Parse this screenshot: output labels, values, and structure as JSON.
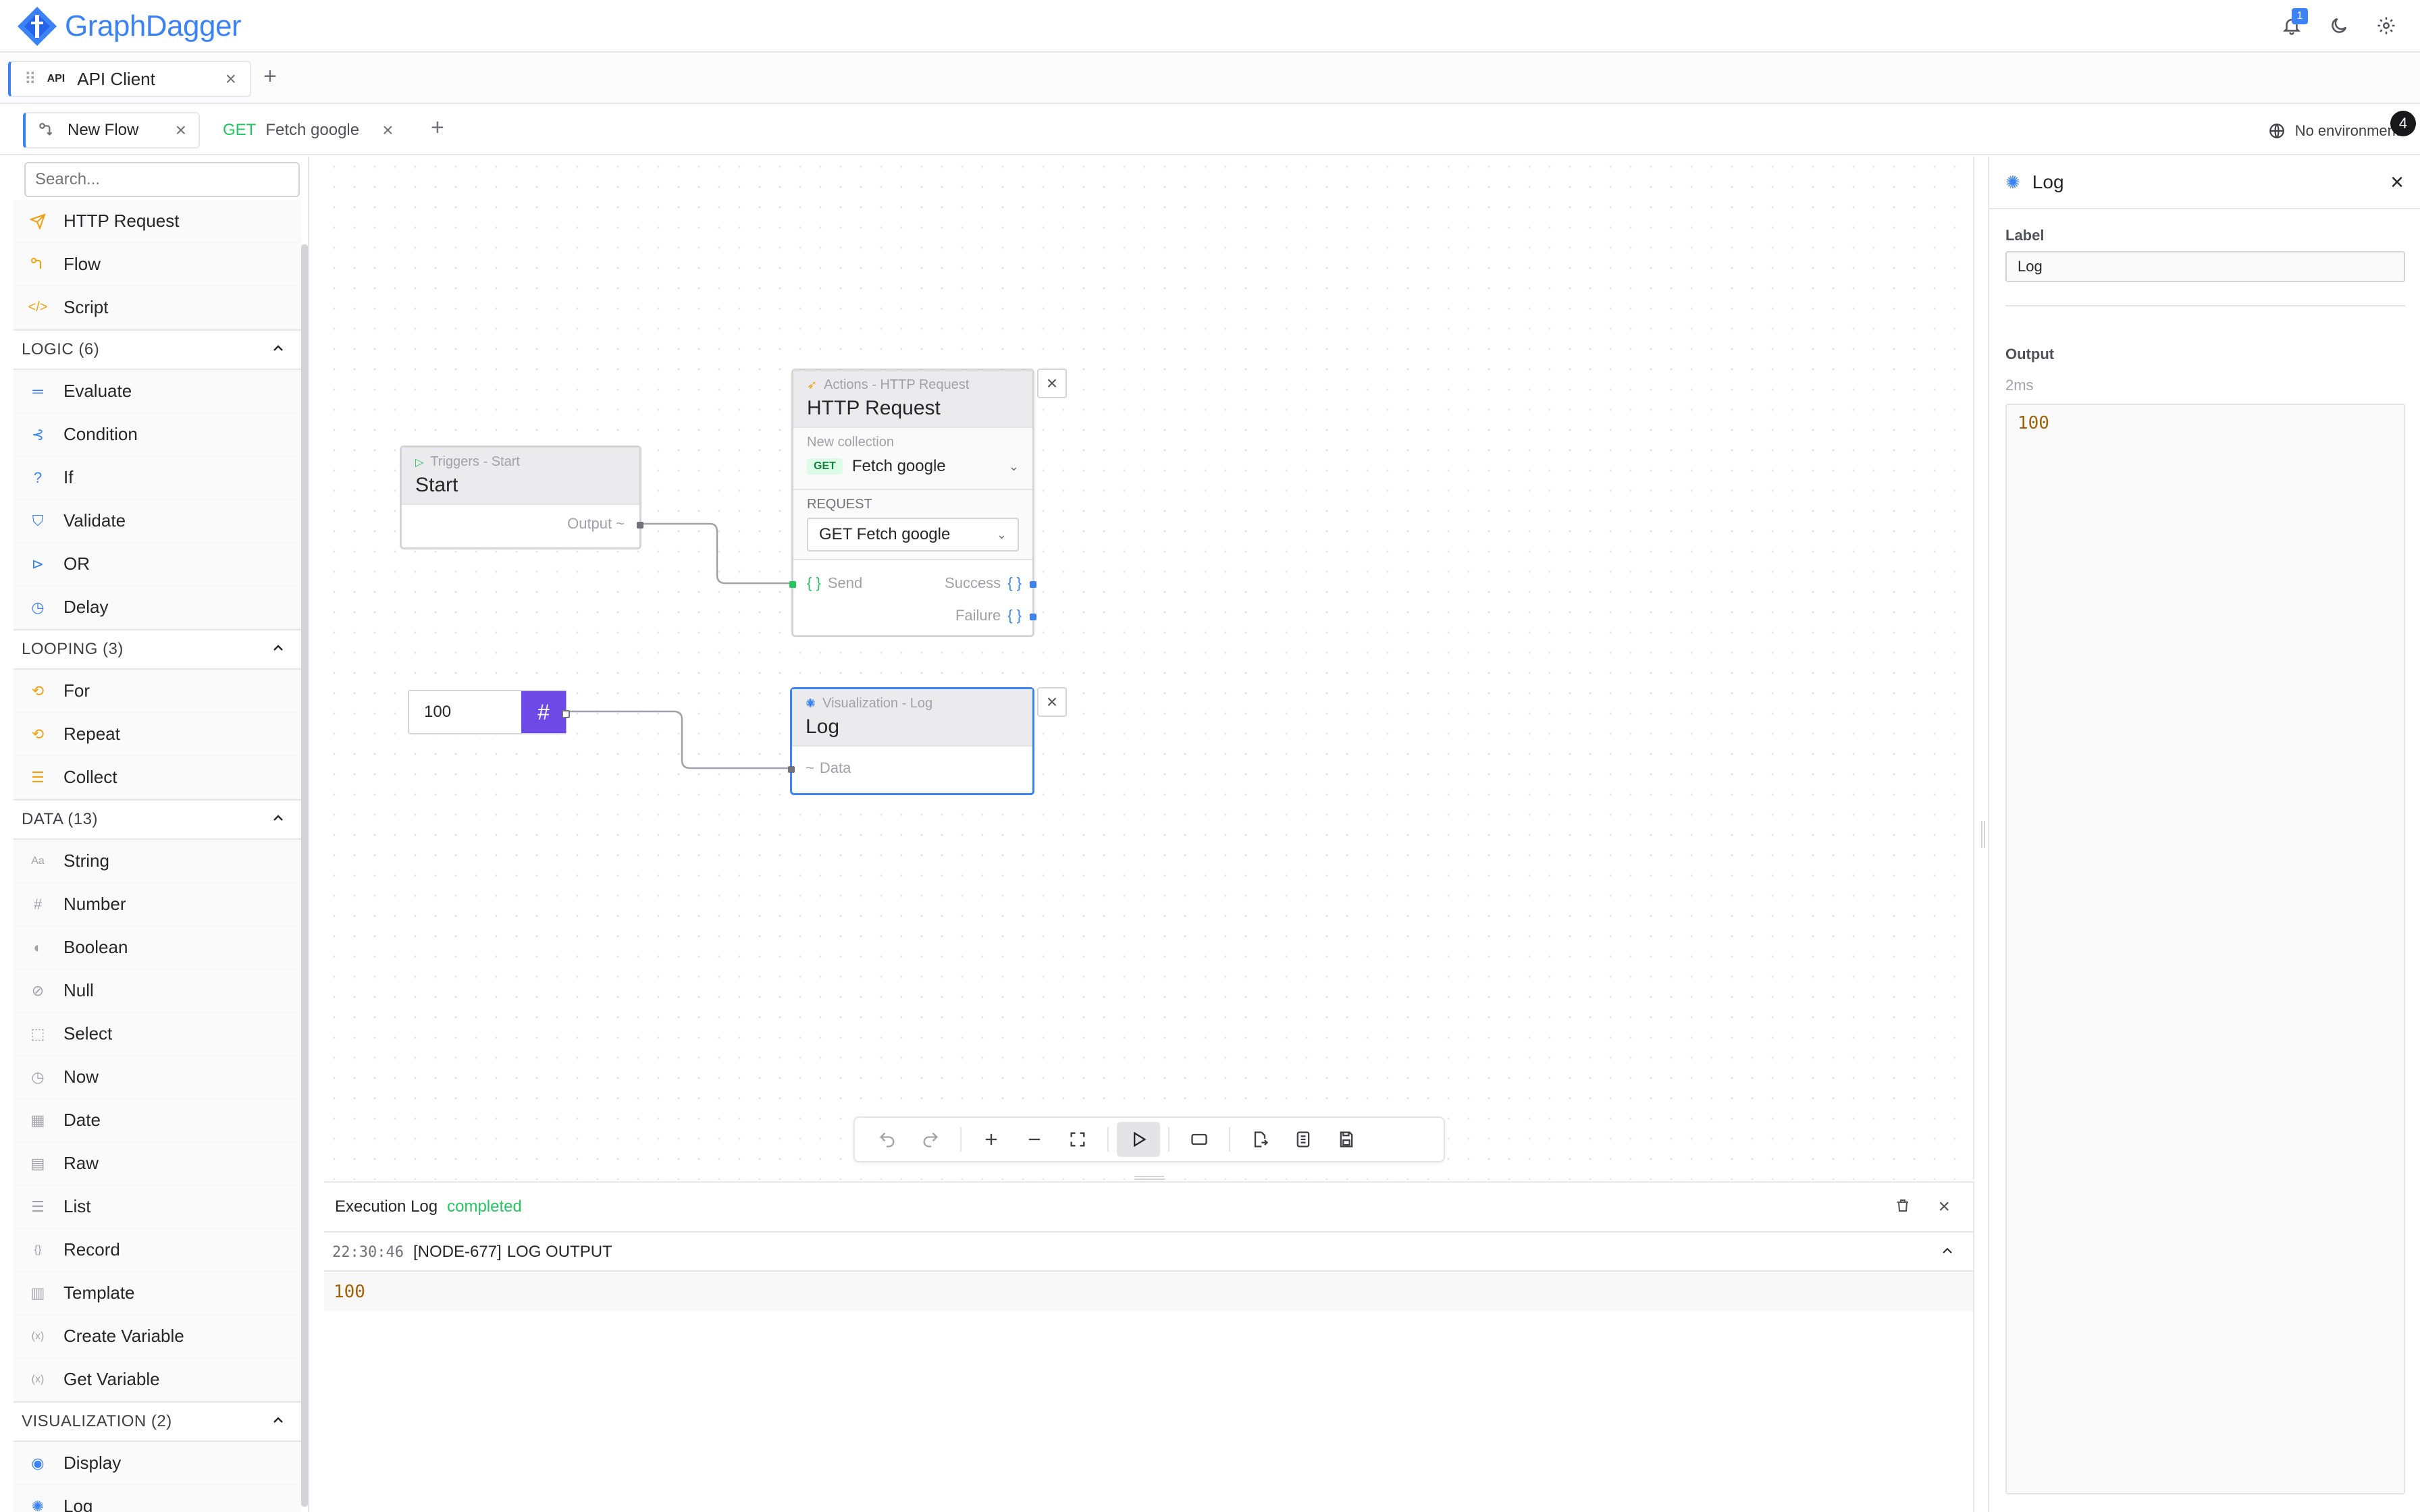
{
  "app": {
    "name": "GraphDagger",
    "notification_count": "1"
  },
  "workspace_tab": {
    "badge": "API",
    "label": "API Client"
  },
  "flow_tabs": [
    {
      "label": "New Flow"
    },
    {
      "method": "GET",
      "label": "Fetch google"
    }
  ],
  "environment": {
    "label": "No environment",
    "badge": "4"
  },
  "sidebar": {
    "search_placeholder": "Search...",
    "top_items": [
      {
        "label": "HTTP Request",
        "icon": "send-icon"
      },
      {
        "label": "Flow",
        "icon": "flow-icon"
      },
      {
        "label": "Script",
        "icon": "code-icon"
      }
    ],
    "sections": [
      {
        "header": "LOGIC (6)",
        "items": [
          {
            "label": "Evaluate",
            "glyph": "═"
          },
          {
            "label": "Condition",
            "glyph": "⊰"
          },
          {
            "label": "If",
            "glyph": "?"
          },
          {
            "label": "Validate",
            "glyph": "⛉"
          },
          {
            "label": "OR",
            "glyph": "⊳"
          },
          {
            "label": "Delay",
            "glyph": "◷"
          }
        ]
      },
      {
        "header": "LOOPING (3)",
        "items": [
          {
            "label": "For",
            "glyph": "⟲"
          },
          {
            "label": "Repeat",
            "glyph": "⟲"
          },
          {
            "label": "Collect",
            "glyph": "☰"
          }
        ]
      },
      {
        "header": "DATA (13)",
        "items": [
          {
            "label": "String",
            "glyph": "Aa"
          },
          {
            "label": "Number",
            "glyph": "#"
          },
          {
            "label": "Boolean",
            "glyph": "◐"
          },
          {
            "label": "Null",
            "glyph": "⊘"
          },
          {
            "label": "Select",
            "glyph": "⬚"
          },
          {
            "label": "Now",
            "glyph": "◷"
          },
          {
            "label": "Date",
            "glyph": "▦"
          },
          {
            "label": "Raw",
            "glyph": "▤"
          },
          {
            "label": "List",
            "glyph": "☰"
          },
          {
            "label": "Record",
            "glyph": "{}"
          },
          {
            "label": "Template",
            "glyph": "▥"
          },
          {
            "label": "Create Variable",
            "glyph": "(x)"
          },
          {
            "label": "Get Variable",
            "glyph": "(x)"
          }
        ]
      },
      {
        "header": "VISUALIZATION (2)",
        "items": [
          {
            "label": "Display",
            "glyph": "◉"
          },
          {
            "label": "Log",
            "glyph": "✺"
          }
        ]
      }
    ]
  },
  "canvas": {
    "start_node": {
      "subtitle": "Triggers - Start",
      "title": "Start",
      "output": "Output"
    },
    "http_node": {
      "subtitle": "Actions - HTTP Request",
      "title": "HTTP Request",
      "collection_label": "New collection",
      "method": "GET",
      "request_name": "Fetch google",
      "request_section": "REQUEST",
      "select_value": "GET Fetch google",
      "send": "Send",
      "success": "Success",
      "failure": "Failure"
    },
    "number_node": {
      "value": "100",
      "symbol": "#"
    },
    "log_node": {
      "subtitle": "Visualization - Log",
      "title": "Log",
      "input": "Data"
    }
  },
  "execution_log": {
    "title": "Execution Log",
    "status": "completed",
    "entries": [
      {
        "time": "22:30:46",
        "node": "[NODE-677]",
        "type": "LOG OUTPUT",
        "output": "100"
      }
    ]
  },
  "right_panel": {
    "title": "Log",
    "label_field": {
      "label": "Label",
      "value": "Log"
    },
    "output": {
      "label": "Output",
      "duration": "2ms",
      "value": "100"
    }
  },
  "colors": {
    "accent": "#3b82f6",
    "success": "#22c55e",
    "number_node": "#6d4ae6"
  }
}
